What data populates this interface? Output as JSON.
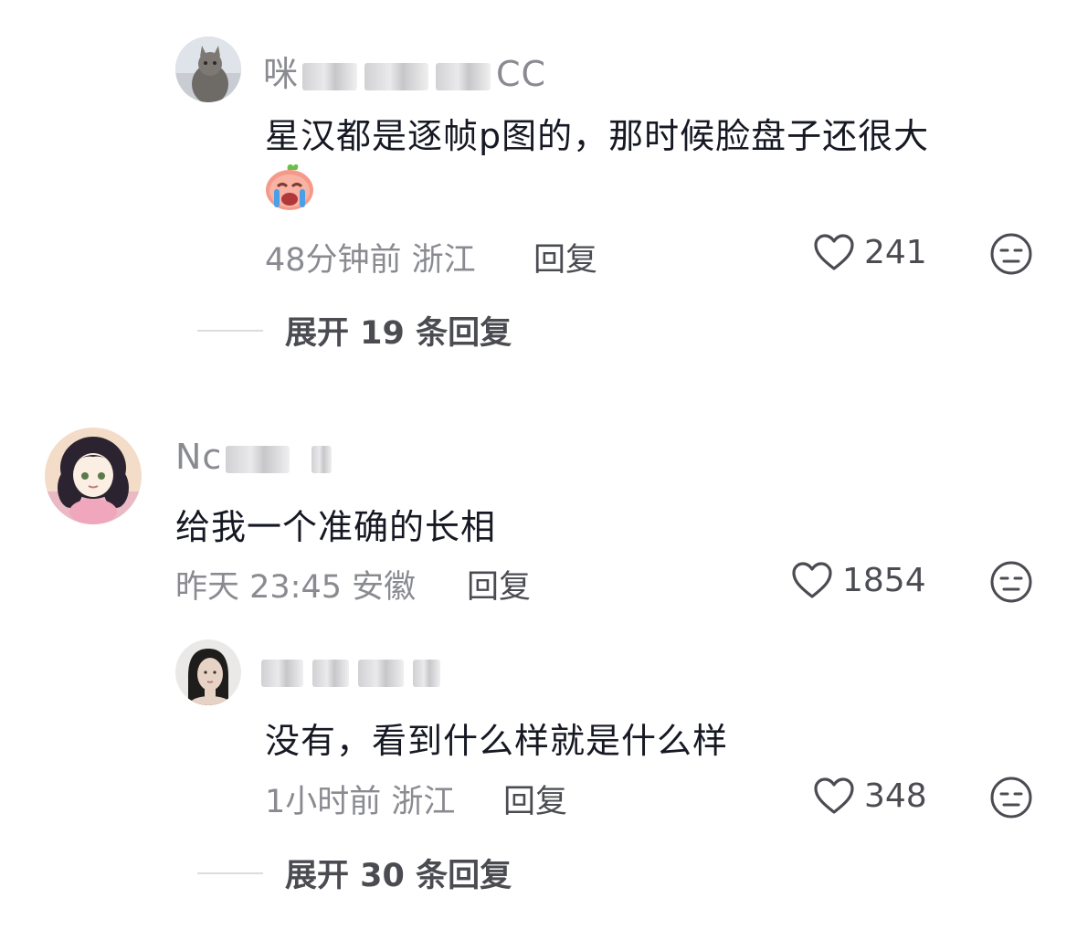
{
  "comments": [
    {
      "username_visible": "咪",
      "username_suffix": "CC",
      "text": "星汉都是逐帧p图的，那时候脸盘子还很大",
      "time_location": "48分钟前 浙江",
      "reply_label": "回复",
      "likes": "241",
      "avatar_icon": "cat-avatar-icon",
      "emoji_icon": "crying-face-emoji-icon",
      "expand": "展开 19 条回复"
    },
    {
      "username_visible": "Nc",
      "text": "给我一个准确的长相",
      "time_location": "昨天 23:45 安徽",
      "reply_label": "回复",
      "likes": "1854",
      "avatar_icon": "anime-girl-avatar-icon"
    },
    {
      "text": "没有，看到什么样就是什么样",
      "time_location": "1小时前 浙江",
      "reply_label": "回复",
      "likes": "348",
      "avatar_icon": "woman-portrait-avatar-icon",
      "expand": "展开 30 条回复"
    }
  ],
  "colors": {
    "meta": "#8a8b91",
    "text": "#161823",
    "action": "#4b4c52"
  }
}
